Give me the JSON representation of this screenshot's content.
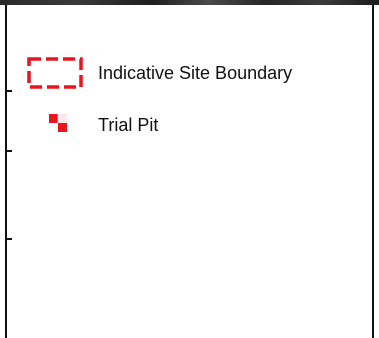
{
  "legend": {
    "items": [
      {
        "label": "Indicative Site Boundary",
        "symbol": "dashed-boundary-icon",
        "color": "#e8141e"
      },
      {
        "label": "Trial Pit",
        "symbol": "trial-pit-icon",
        "color": "#e8141e"
      }
    ]
  }
}
